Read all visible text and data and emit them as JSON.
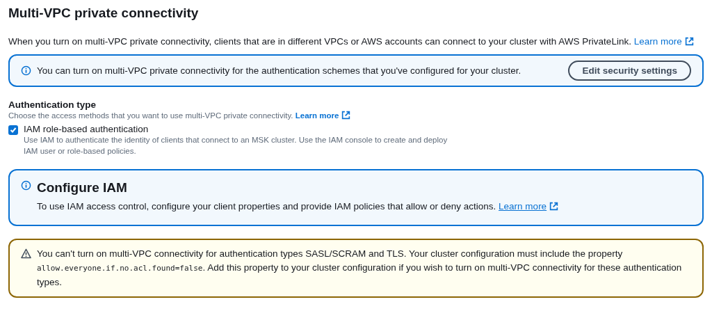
{
  "heading": "Multi-VPC private connectivity",
  "intro": {
    "text": "When you turn on multi-VPC private connectivity, clients that are in different VPCs or AWS accounts can connect to your cluster with AWS PrivateLink.",
    "link": "Learn more"
  },
  "info_alert": {
    "text": "You can turn on multi-VPC private connectivity for the authentication schemes that you've configured for your cluster.",
    "button": "Edit security settings"
  },
  "authentication_type": {
    "label": "Authentication type",
    "description": "Choose the access methods that you want to use multi-VPC private connectivity.",
    "link": "Learn more",
    "options": [
      {
        "label": "IAM role-based authentication",
        "description": "Use IAM to authenticate the identity of clients that connect to an MSK cluster. Use the IAM console to create and deploy IAM user or role-based policies.",
        "checked": true
      }
    ]
  },
  "configure_panel": {
    "title": "Configure IAM",
    "text": "To use IAM access control, configure your client properties and provide IAM policies that allow or deny actions.",
    "link": "Learn more"
  },
  "warning_alert": {
    "text_before": "You can't turn on multi-VPC connectivity for authentication types SASL/SCRAM and TLS. Your cluster configuration must include the property",
    "code": "allow.everyone.if.no.acl.found=false",
    "text_after": ". Add this property to your cluster configuration if you wish to turn on multi-VPC connectivity for these authentication types."
  }
}
